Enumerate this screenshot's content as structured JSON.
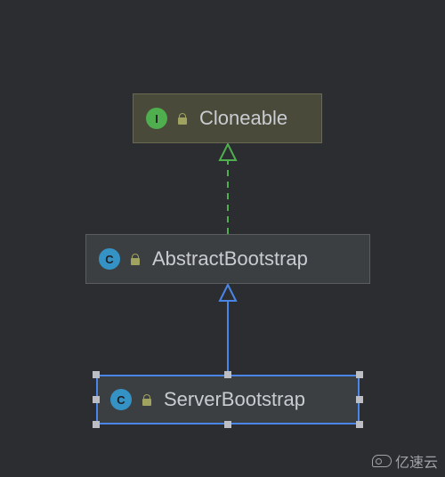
{
  "nodes": {
    "cloneable": {
      "kind": "interface",
      "badge_letter": "I",
      "label": "Cloneable",
      "selected": false
    },
    "abstract_bootstrap": {
      "kind": "class",
      "badge_letter": "C",
      "label": "AbstractBootstrap",
      "selected": false
    },
    "server_bootstrap": {
      "kind": "class",
      "badge_letter": "C",
      "label": "ServerBootstrap",
      "selected": true
    }
  },
  "edges": [
    {
      "from": "abstract_bootstrap",
      "to": "cloneable",
      "style": "implements"
    },
    {
      "from": "server_bootstrap",
      "to": "abstract_bootstrap",
      "style": "extends"
    }
  ],
  "colors": {
    "implements": "#4fae4e",
    "extends": "#4a86e8",
    "node_bg": "#3c3f41",
    "interface_bg": "#4a4a3a",
    "text": "#c9ccd1"
  },
  "watermark": {
    "text": "亿速云"
  }
}
